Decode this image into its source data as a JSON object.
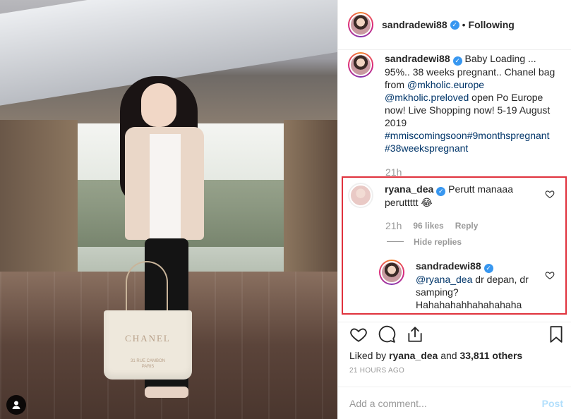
{
  "photo": {
    "bag_brand": "CHANEL",
    "bag_sub": "31 RUE CAMBON\nPARIS",
    "icons": {
      "user_tag": "user-icon"
    }
  },
  "post": {
    "username": "sandradewi88",
    "follow_state": "Following",
    "separator": "•"
  },
  "caption": {
    "username": "sandradewi88",
    "text_1": "Baby Loading ... 95%.. 38 weeks pregnant.. Chanel bag from ",
    "mention_1": "@mkholic.europe",
    "mention_2": "@mkholic.preloved",
    "text_2": " open Po Europe now! Live Shopping now! 5-19 August 2019 ",
    "hashtags": "#mmiscomingsoon#9monthspregnant #38weekspregnant",
    "time": "21h"
  },
  "comment": {
    "username": "ryana_dea",
    "text": "Perutt manaaa peruttttt 😂",
    "time": "21h",
    "likes": "96 likes",
    "reply": "Reply",
    "hide_replies": "Hide replies"
  },
  "reply": {
    "username": "sandradewi88",
    "mention": "@ryana_dea",
    "text": " dr depan, dr samping? Hahahahahhahahahaha"
  },
  "actions": {
    "icons": [
      "heart-icon",
      "comment-icon",
      "share-icon",
      "bookmark-icon"
    ]
  },
  "likes": {
    "prefix": "Liked by ",
    "user": "ryana_dea",
    "middle": " and ",
    "others": "33,811 others"
  },
  "age": "21 HOURS AGO",
  "add_comment": {
    "placeholder": "Add a comment...",
    "post_label": "Post"
  },
  "colors": {
    "highlight": "#e0323d",
    "verified": "#3897f0",
    "link": "#003569",
    "post_disabled": "#b2dffc"
  }
}
